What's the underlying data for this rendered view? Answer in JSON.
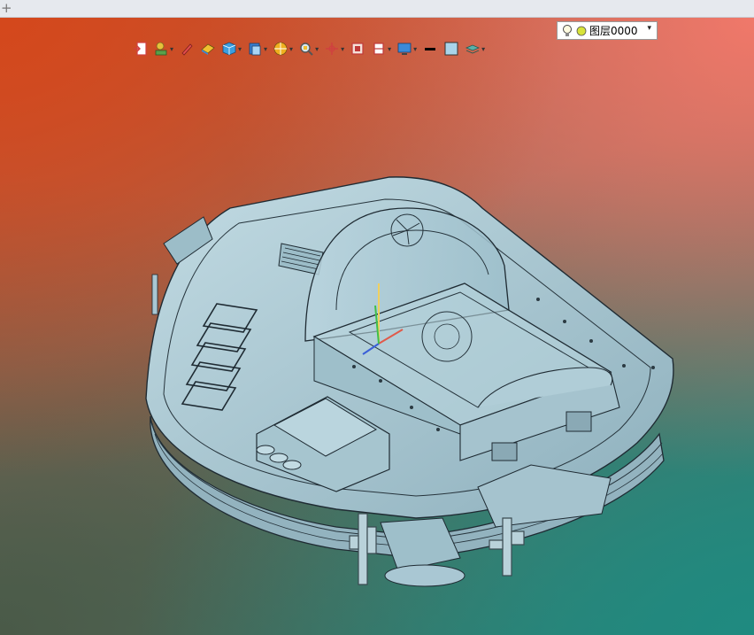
{
  "tabstrip": {
    "new_tab_symbol": "+"
  },
  "toolbar": {
    "tools": [
      {
        "name": "import-icon",
        "has_dropdown": false
      },
      {
        "name": "light-icon",
        "has_dropdown": true
      },
      {
        "name": "pen-icon",
        "has_dropdown": false
      },
      {
        "name": "eraser-icon",
        "has_dropdown": false
      },
      {
        "name": "cube-icon",
        "has_dropdown": true
      },
      {
        "name": "page-icon",
        "has_dropdown": true
      },
      {
        "name": "render-icon",
        "has_dropdown": true
      },
      {
        "name": "zoom-icon",
        "has_dropdown": true
      },
      {
        "name": "axis-icon",
        "has_dropdown": true
      },
      {
        "name": "frame-icon",
        "has_dropdown": false
      },
      {
        "name": "section-icon",
        "has_dropdown": true
      },
      {
        "name": "monitor-icon",
        "has_dropdown": true
      },
      {
        "name": "line-color-icon",
        "has_dropdown": false
      },
      {
        "name": "fill-color-icon",
        "has_dropdown": false
      },
      {
        "name": "layers-icon",
        "has_dropdown": true
      }
    ],
    "dropdown_glyph": "▾"
  },
  "layer": {
    "name": "图层0000",
    "arrow": "▾",
    "bulb_icon": "bulb-icon",
    "status_color": "#d8e33a"
  },
  "colors": {
    "tabstrip": "#e6e9ee",
    "model_body": "#a9c7d3",
    "model_edge": "#1f2b33"
  }
}
